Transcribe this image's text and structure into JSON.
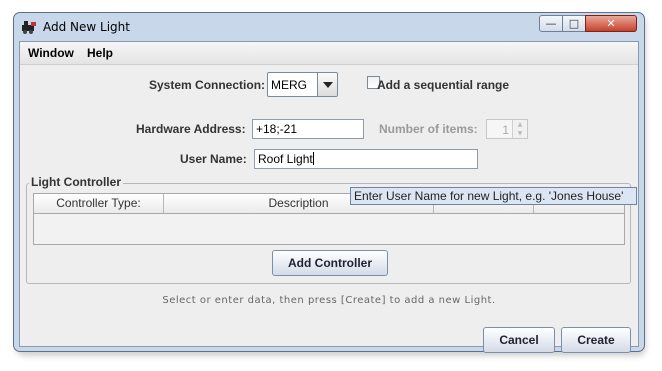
{
  "window": {
    "title": "Add New Light",
    "controls": {
      "minimize": "—",
      "maximize": "□",
      "close": "✕"
    }
  },
  "menu": {
    "items": [
      "Window",
      "Help"
    ]
  },
  "form": {
    "system_connection_label": "System Connection:",
    "system_connection_value": "MERG",
    "sequential_range_label": "Add a sequential range",
    "sequential_range_checked": false,
    "hardware_address_label": "Hardware Address:",
    "hardware_address_value": "+18;-21",
    "number_of_items_label": "Number of items:",
    "number_of_items_value": "1",
    "user_name_label": "User Name:",
    "user_name_value": "Roof Light"
  },
  "light_controller": {
    "title": "Light Controller",
    "columns": [
      "Controller Type:",
      "Description",
      "",
      ""
    ],
    "add_button": "Add Controller"
  },
  "tooltip": "Enter User Name for new Light, e.g. 'Jones House'",
  "hint": "Select or enter data, then press [Create] to add a new Light.",
  "buttons": {
    "cancel": "Cancel",
    "create": "Create"
  },
  "colors": {
    "title_bar": "#c9d7ea",
    "close_button": "#c7422c",
    "panel": "#eeeeee"
  }
}
